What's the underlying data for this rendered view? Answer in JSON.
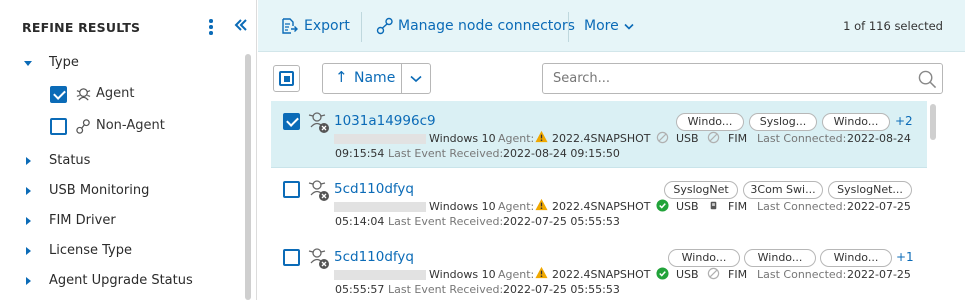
{
  "filter_panel": {
    "title": "REFINE RESULTS",
    "groups": [
      {
        "label": "Type",
        "expanded": true,
        "options": [
          {
            "label": "Agent",
            "checked": true,
            "icon": "agent-icon"
          },
          {
            "label": "Non-Agent",
            "checked": false,
            "icon": "non-agent-icon"
          }
        ]
      },
      {
        "label": "Status",
        "expanded": false
      },
      {
        "label": "USB Monitoring",
        "expanded": false
      },
      {
        "label": "FIM Driver",
        "expanded": false
      },
      {
        "label": "License Type",
        "expanded": false
      },
      {
        "label": "Agent Upgrade Status",
        "expanded": false
      }
    ]
  },
  "toolbar": {
    "export_label": "Export",
    "manage_label": "Manage node connectors",
    "more_label": "More",
    "selection_count": "1 of 116 selected"
  },
  "list_header": {
    "sort_label": "Name",
    "search_placeholder": "Search..."
  },
  "rows": [
    {
      "selected": true,
      "name": "1031a14996c9",
      "os": "Windows 10",
      "agent_label": "Agent:",
      "agent_version": "2022.4SNAPSHOT",
      "agent_status": "warning",
      "usb_status": "disabled",
      "usb_label": "USB",
      "fim_status": "disabled",
      "fim_label": "FIM",
      "last_connected_label": "Last Connected:",
      "last_connected": "2022-08-24",
      "time": "09:15:54",
      "last_event_label": "Last Event Received:",
      "last_event": "2022-08-24 09:15:50",
      "tags": [
        "Windo...",
        "Syslog...",
        "Windo..."
      ],
      "more_tags": "+2"
    },
    {
      "selected": false,
      "name": "5cd110dfyq",
      "os": "Windows 10",
      "agent_label": "Agent:",
      "agent_version": "2022.4SNAPSHOT",
      "agent_status": "ok",
      "usb_status": "ok",
      "usb_label": "USB",
      "fim_status": "driver",
      "fim_label": "FIM",
      "last_connected_label": "Last Connected:",
      "last_connected": "2022-07-25",
      "time": "05:14:04",
      "last_event_label": "Last Event Received:",
      "last_event": "2022-07-25 05:55:53",
      "tags": [
        "SyslogNet",
        "3Com Swi...",
        "SyslogNet..."
      ],
      "more_tags": ""
    },
    {
      "selected": false,
      "name": "5cd110dfyq",
      "os": "Windows 10",
      "agent_label": "Agent:",
      "agent_version": "2022.4SNAPSHOT",
      "agent_status": "warning",
      "usb_status": "ok",
      "usb_label": "USB",
      "fim_status": "disabled",
      "fim_label": "FIM",
      "last_connected_label": "Last Connected:",
      "last_connected": "2022-07-25",
      "time": "05:55:57",
      "last_event_label": "Last Event Received:",
      "last_event": "2022-07-25 05:55:53",
      "tags": [
        "Windo...",
        "Windo...",
        "Windo..."
      ],
      "more_tags": "+1"
    }
  ],
  "colors": {
    "accent": "#0b6bb7",
    "toolbar_bg": "#e6f5f8",
    "selected_row_bg": "#daf0f4",
    "warning": "#f0a800",
    "ok": "#22a33a"
  }
}
